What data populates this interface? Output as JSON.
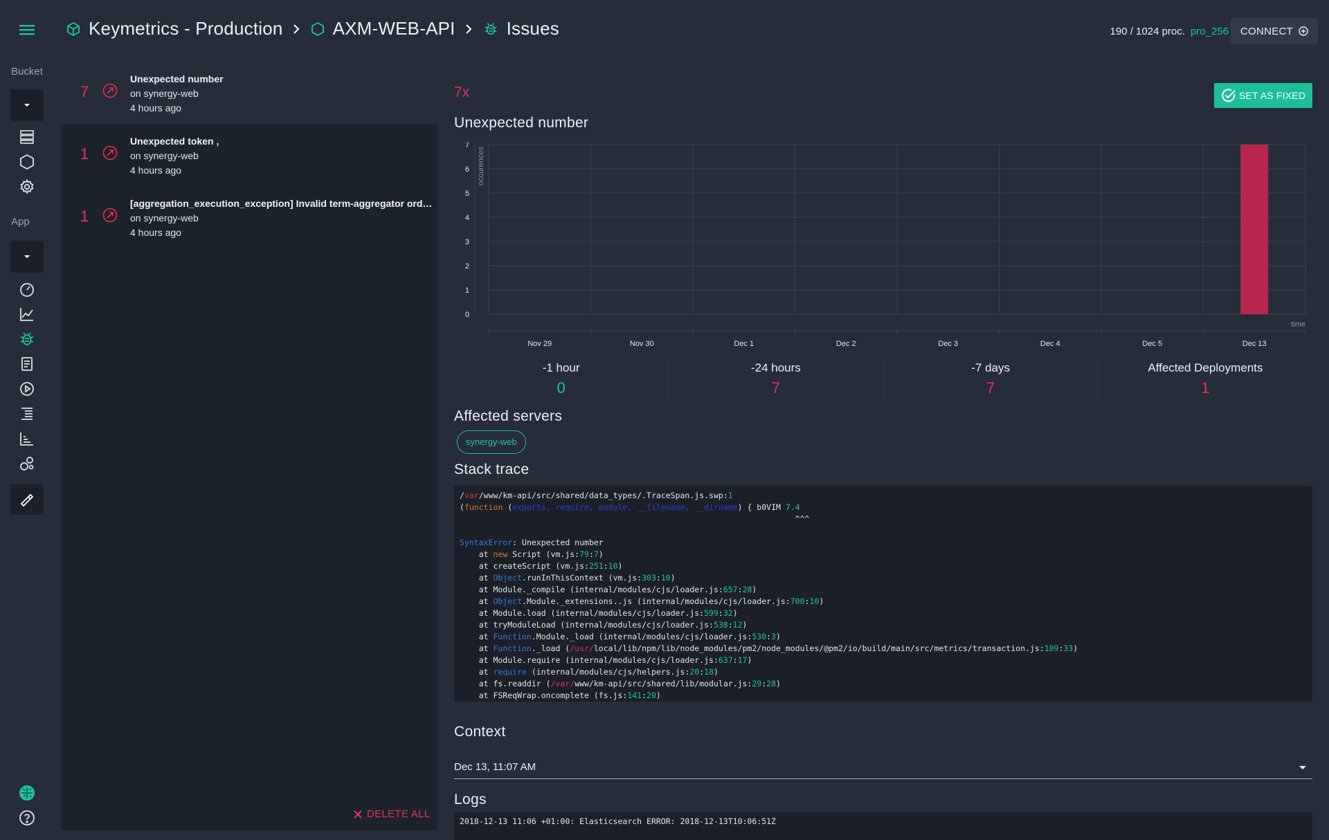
{
  "rail": {
    "bucket_label": "Bucket",
    "app_label": "App",
    "accent": "#21c4a0"
  },
  "header": {
    "breadcrumb": [
      "Keymetrics - Production",
      "AXM-WEB-API",
      "Issues"
    ],
    "proc_count": "190 / 1024 proc.",
    "plan": "pro_256",
    "connect_label": "CONNECT"
  },
  "issues": [
    {
      "count": "7",
      "title": "Unexpected number",
      "source": "on synergy-web",
      "time": "4 hours ago",
      "selected": true
    },
    {
      "count": "1",
      "title": "Unexpected token ,",
      "source": "on synergy-web",
      "time": "4 hours ago",
      "selected": false
    },
    {
      "count": "1",
      "title": "[aggregation_execution_exception] Invalid term-aggregator order path [memory]. Unknown aggregation [memory]",
      "source": "on synergy-web",
      "time": "4 hours ago",
      "selected": false
    }
  ],
  "delete_all_label": "DELETE ALL",
  "detail": {
    "occurrences": "7x",
    "set_fixed_label": "SET AS FIXED",
    "title": "Unexpected number",
    "stats": [
      {
        "label": "-1 hour",
        "value": "0",
        "color": "#21c4a0"
      },
      {
        "label": "-24 hours",
        "value": "7",
        "color": "#e8305c"
      },
      {
        "label": "-7 days",
        "value": "7",
        "color": "#e8305c"
      },
      {
        "label": "Affected Deployments",
        "value": "1",
        "color": "#e8305c"
      }
    ],
    "servers_heading": "Affected servers",
    "servers": [
      "synergy-web"
    ],
    "stack_heading": "Stack trace",
    "context_heading": "Context",
    "context_value": "Dec 13, 11:07 AM",
    "logs_heading": "Logs",
    "log_line": "2018-12-13 11:06 +01:00: Elasticsearch ERROR: 2018-12-13T10:06:51Z"
  },
  "chart_data": {
    "type": "bar",
    "categories": [
      "Nov 29",
      "Nov 30",
      "Dec 1",
      "Dec 2",
      "Dec 3",
      "Dec 4",
      "Dec 5",
      "Dec 13"
    ],
    "series": [
      {
        "values": [
          0,
          0,
          0,
          0,
          0,
          0,
          0,
          7
        ]
      }
    ],
    "ylabel": "occurences",
    "xlabel": "time",
    "ylim": [
      0,
      7
    ],
    "yticks": [
      "0",
      "1",
      "2",
      "3",
      "4",
      "5",
      "6",
      "7"
    ],
    "grid": true,
    "bar_color": "#b8264e"
  }
}
